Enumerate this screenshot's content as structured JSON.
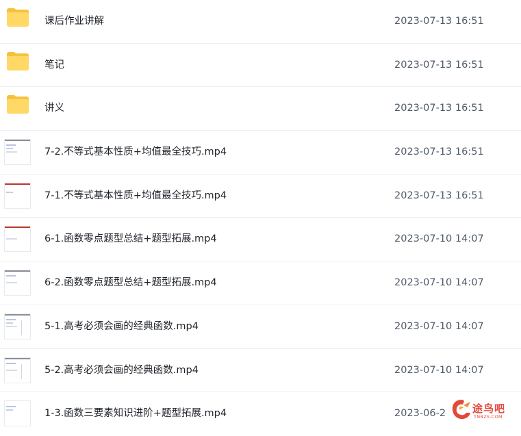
{
  "files": [
    {
      "type": "folder",
      "name": "课后作业讲解",
      "modified": "2023-07-13 16:51",
      "icon": "folder-icon"
    },
    {
      "type": "folder",
      "name": "笔记",
      "modified": "2023-07-13 16:51",
      "icon": "folder-icon"
    },
    {
      "type": "folder",
      "name": "讲义",
      "modified": "2023-07-13 16:51",
      "icon": "folder-icon"
    },
    {
      "type": "video",
      "name": "7-2.不等式基本性质+均值最全技巧.mp4",
      "modified": "2023-07-13 16:51",
      "icon": "video-thumbnail"
    },
    {
      "type": "video",
      "name": "7-1.不等式基本性质+均值最全技巧.mp4",
      "modified": "2023-07-13 16:51",
      "icon": "video-thumbnail"
    },
    {
      "type": "video",
      "name": "6-1.函数零点题型总结+题型拓展.mp4",
      "modified": "2023-07-10 14:07",
      "icon": "video-thumbnail"
    },
    {
      "type": "video",
      "name": "6-2.函数零点题型总结+题型拓展.mp4",
      "modified": "2023-07-10 14:07",
      "icon": "video-thumbnail"
    },
    {
      "type": "video",
      "name": "5-1.高考必须会画的经典函数.mp4",
      "modified": "2023-07-10 14:07",
      "icon": "video-thumbnail"
    },
    {
      "type": "video",
      "name": "5-2.高考必须会画的经典函数.mp4",
      "modified": "2023-07-10 14:07",
      "icon": "video-thumbnail"
    },
    {
      "type": "video",
      "name": "1-3.函数三要素知识进阶+题型拓展.mp4",
      "modified": "2023-06-2",
      "icon": "video-thumbnail"
    }
  ],
  "watermark": {
    "text": "途鸟吧",
    "subtext": "TNBZS.COM"
  },
  "colors": {
    "folder": "#f6c23e",
    "watermark": "#e3483b",
    "divider": "#eef0f3"
  }
}
